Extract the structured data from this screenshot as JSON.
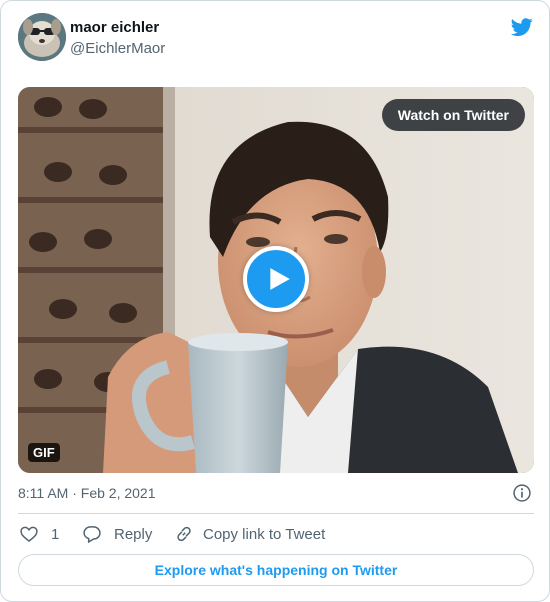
{
  "author": {
    "name": "maor eichler",
    "handle": "@EichlerMaor"
  },
  "media": {
    "watch_label": "Watch on Twitter",
    "badge": "GIF"
  },
  "tweet": {
    "timestamp": "8:11 AM · Feb 2, 2021"
  },
  "actions": {
    "like_count": "1",
    "reply_label": "Reply",
    "copy_label": "Copy link to Tweet"
  },
  "explore_label": "Explore what's happening on Twitter",
  "icons": {
    "brand": "twitter-bird-icon",
    "play": "play-icon",
    "info": "info-icon",
    "like": "heart-icon",
    "reply": "reply-bubble-icon",
    "copy": "link-icon"
  },
  "colors": {
    "accent": "#1d9bf0",
    "text": "#0f1419",
    "muted": "#536471",
    "border": "#cfd9de"
  }
}
